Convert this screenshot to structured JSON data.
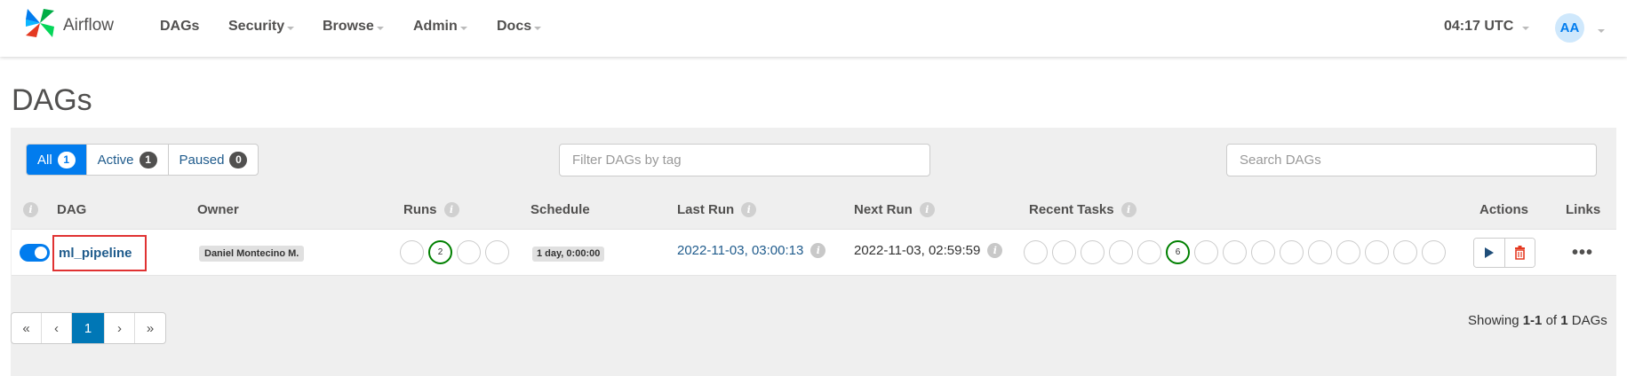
{
  "navbar": {
    "brand": "Airflow",
    "menu": [
      {
        "label": "DAGs",
        "dropdown": false
      },
      {
        "label": "Security",
        "dropdown": true
      },
      {
        "label": "Browse",
        "dropdown": true
      },
      {
        "label": "Admin",
        "dropdown": true
      },
      {
        "label": "Docs",
        "dropdown": true
      }
    ],
    "clock": "04:17 UTC",
    "avatar": "AA"
  },
  "page": {
    "title": "DAGs"
  },
  "filters": {
    "all": {
      "label": "All",
      "count": "1"
    },
    "active": {
      "label": "Active",
      "count": "1"
    },
    "paused": {
      "label": "Paused",
      "count": "0"
    },
    "tag_placeholder": "Filter DAGs by tag",
    "search_placeholder": "Search DAGs"
  },
  "table": {
    "headers": {
      "dag": "DAG",
      "owner": "Owner",
      "runs": "Runs",
      "schedule": "Schedule",
      "last_run": "Last Run",
      "next_run": "Next Run",
      "recent_tasks": "Recent Tasks",
      "actions": "Actions",
      "links": "Links"
    },
    "row": {
      "paused": false,
      "dag_id": "ml_pipeline",
      "owner": "Daniel Montecino M.",
      "runs": [
        "",
        "2",
        "",
        ""
      ],
      "schedule": "1 day, 0:00:00",
      "last_run": "2022-11-03, 03:00:13",
      "next_run": "2022-11-03, 02:59:59",
      "recent_tasks": [
        "",
        "",
        "",
        "",
        "",
        "6",
        "",
        "",
        "",
        "",
        "",
        "",
        "",
        "",
        ""
      ],
      "links_icon": "•••"
    }
  },
  "pagination": {
    "first": "«",
    "prev": "‹",
    "current": "1",
    "next": "›",
    "last": "»"
  },
  "footer": {
    "showing_prefix": "Showing",
    "range": "1-1",
    "of": "of",
    "total": "1",
    "suffix": "DAGs"
  },
  "colors": {
    "primary": "#017cee",
    "success": "#008000",
    "danger": "#e43921",
    "link": "#1f5b8c"
  }
}
